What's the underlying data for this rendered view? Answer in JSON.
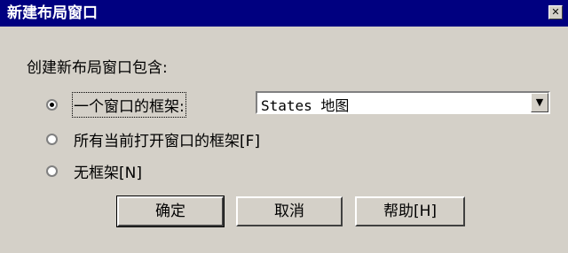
{
  "dialog": {
    "title": "新建布局窗口",
    "close_glyph": "✕",
    "prompt": "创建新布局窗口包含:",
    "options": [
      {
        "label": "一个窗口的框架:",
        "selected": true
      },
      {
        "label": "所有当前打开窗口的框架[F]",
        "selected": false
      },
      {
        "label": "无框架[N]",
        "selected": false
      }
    ],
    "combo": {
      "value": "States 地图",
      "arrow_glyph": "▼"
    },
    "buttons": {
      "ok": "确定",
      "cancel": "取消",
      "help": "帮助[H]"
    }
  },
  "colors": {
    "titlebar": "#000080",
    "face": "#d4d0c8"
  }
}
